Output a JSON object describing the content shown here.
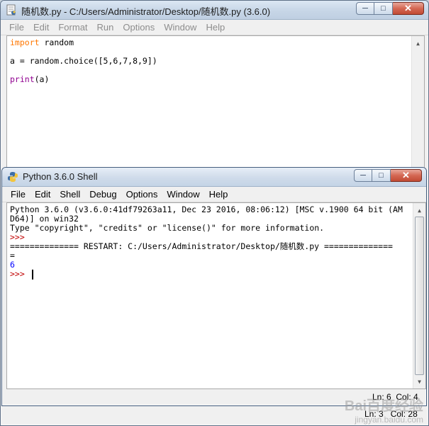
{
  "editor": {
    "title": "随机数.py - C:/Users/Administrator/Desktop/随机数.py (3.6.0)",
    "menu": [
      "File",
      "Edit",
      "Format",
      "Run",
      "Options",
      "Window",
      "Help"
    ],
    "code": {
      "line1_kw": "import",
      "line1_rest": " random",
      "line2": "a = random.choice([5,6,7,8,9])",
      "line3_fn": "print",
      "line3_rest": "(a)"
    },
    "status": {
      "ln": "Ln: 3",
      "col": "Col: 28"
    }
  },
  "shell": {
    "title": "Python 3.6.0 Shell",
    "menu": [
      "File",
      "Edit",
      "Shell",
      "Debug",
      "Options",
      "Window",
      "Help"
    ],
    "lines": {
      "banner1": "Python 3.6.0 (v3.6.0:41df79263a11, Dec 23 2016, 08:06:12) [MSC v.1900 64 bit (AM",
      "banner2": "D64)] on win32",
      "banner3": "Type \"copyright\", \"credits\" or \"license()\" for more information.",
      "prompt1": ">>> ",
      "restart1": "============== RESTART: C:/Users/Administrator/Desktop/随机数.py ==============",
      "restart2": "=",
      "output": "6",
      "prompt2": ">>> "
    },
    "status": {
      "ln": "Ln: 6",
      "col": "Col: 4"
    }
  },
  "watermark": {
    "line1": "Bai百度经验",
    "line2": "jingyan.baidu.com"
  }
}
